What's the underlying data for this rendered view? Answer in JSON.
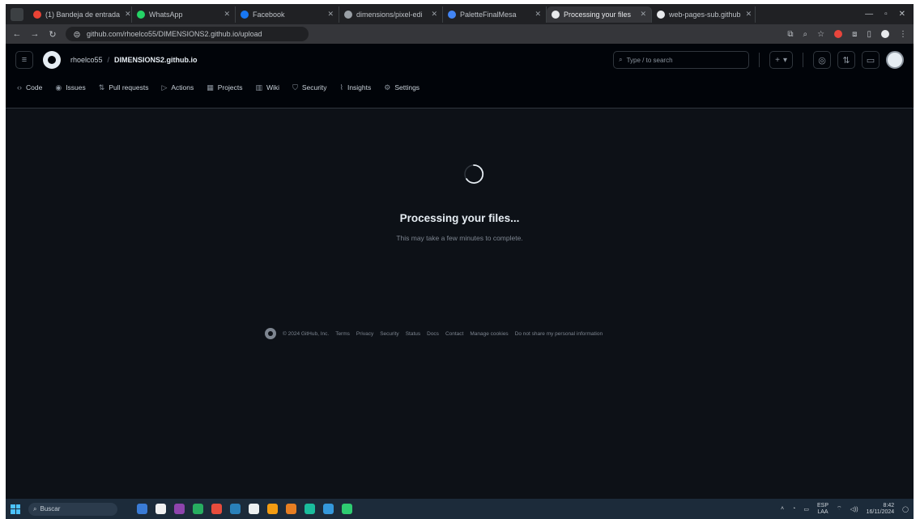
{
  "browser": {
    "tabs": [
      {
        "label": "(1) Bandeja de entrada",
        "color": "#ea4335",
        "active": false
      },
      {
        "label": "WhatsApp",
        "color": "#25d366",
        "active": false
      },
      {
        "label": "Facebook",
        "color": "#1877f2",
        "active": false
      },
      {
        "label": "dimensions/pixel-edi",
        "color": "#9aa0a6",
        "active": false
      },
      {
        "label": "PaletteFinalMesa",
        "color": "#4285f4",
        "active": false
      },
      {
        "label": "Processing your files",
        "color": "#e8eaed",
        "active": true
      },
      {
        "label": "web-pages-sub.github",
        "color": "#e8eaed",
        "active": false
      }
    ],
    "url": "github.com/rhoelco55/DIMENSIONS2.github.io/upload"
  },
  "github": {
    "owner": "rhoelco55",
    "separator": "/",
    "repo": "DIMENSIONS2.github.io",
    "search_placeholder": "Type / to search",
    "search_slash": "/",
    "plus": "+",
    "nav": [
      {
        "label": "Code",
        "icon": "code-icon",
        "glyph": "‹›"
      },
      {
        "label": "Issues",
        "icon": "issues-icon",
        "glyph": "◉"
      },
      {
        "label": "Pull requests",
        "icon": "pull-request-icon",
        "glyph": "⇅"
      },
      {
        "label": "Actions",
        "icon": "actions-icon",
        "glyph": "▷"
      },
      {
        "label": "Projects",
        "icon": "projects-icon",
        "glyph": "▦"
      },
      {
        "label": "Wiki",
        "icon": "wiki-icon",
        "glyph": "▥"
      },
      {
        "label": "Security",
        "icon": "shield-icon",
        "glyph": "⛉"
      },
      {
        "label": "Insights",
        "icon": "insights-icon",
        "glyph": "⌇"
      },
      {
        "label": "Settings",
        "icon": "gear-icon",
        "glyph": "⚙"
      }
    ]
  },
  "main": {
    "title": "Processing your files...",
    "subtitle": "This may take a few minutes to complete."
  },
  "footer": {
    "copyright": "© 2024 GitHub, Inc.",
    "links": [
      "Terms",
      "Privacy",
      "Security",
      "Status",
      "Docs",
      "Contact",
      "Manage cookies",
      "Do not share my personal information"
    ]
  },
  "taskbar": {
    "search_label": "Buscar",
    "apps": [
      "#3a7bd5",
      "#f1f1f1",
      "#8e44ad",
      "#27ae60",
      "#e74c3c",
      "#2980b9",
      "#ecf0f1",
      "#f39c12",
      "#e67e22",
      "#1abc9c",
      "#3498db",
      "#2ecc71"
    ],
    "lang": "ESP",
    "lang2": "LAA",
    "time": "8:42",
    "date": "16/11/2024"
  },
  "colors": {
    "background": "#0d1117",
    "header": "#010409",
    "border": "#30363d"
  }
}
